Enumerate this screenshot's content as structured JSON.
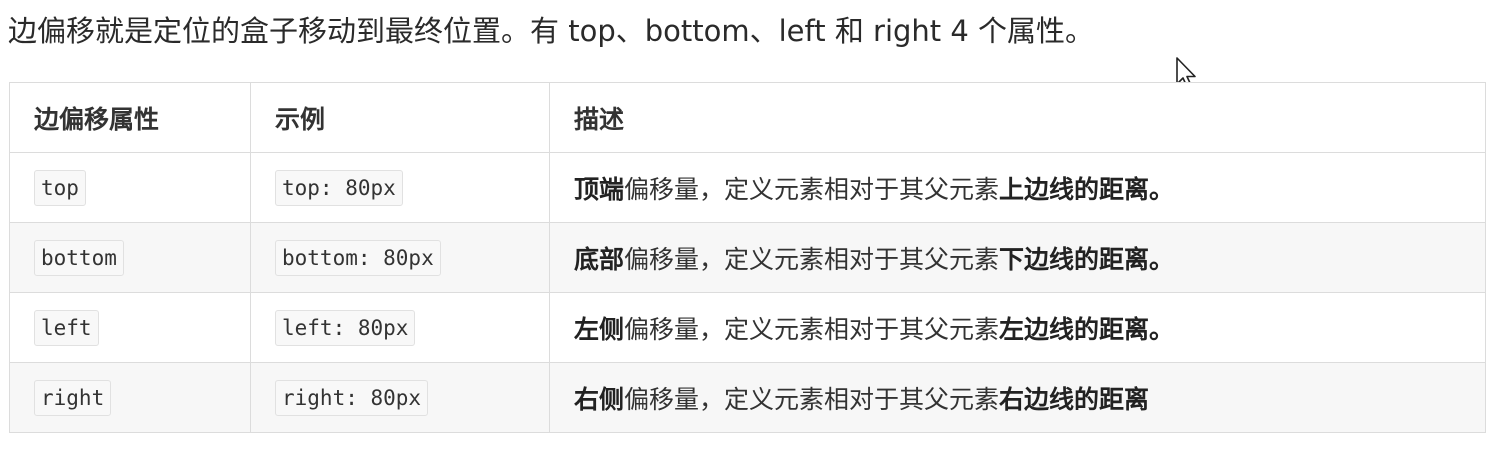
{
  "intro": "边偏移就是定位的盒子移动到最终位置。有 top、bottom、left 和 right  4 个属性。",
  "table": {
    "headers": [
      "边偏移属性",
      "示例",
      "描述"
    ],
    "rows": [
      {
        "property": "top",
        "example": "top: 80px",
        "desc_lead": "顶端",
        "desc_mid": "偏移量，定义元素相对于其父元素",
        "desc_tail": "上边线的距离。"
      },
      {
        "property": "bottom",
        "example": "bottom: 80px",
        "desc_lead": "底部",
        "desc_mid": "偏移量，定义元素相对于其父元素",
        "desc_tail": "下边线的距离。"
      },
      {
        "property": "left",
        "example": "left: 80px",
        "desc_lead": "左侧",
        "desc_mid": "偏移量，定义元素相对于其父元素",
        "desc_tail": "左边线的距离。"
      },
      {
        "property": "right",
        "example": "right: 80px",
        "desc_lead": "右侧",
        "desc_mid": "偏移量，定义元素相对于其父元素",
        "desc_tail": "右边线的距离"
      }
    ]
  },
  "colors": {
    "border": "#dcdcdc",
    "stripe": "#f7f7f7",
    "code_bg": "#f8f8f8",
    "text": "#333333"
  },
  "icons": {
    "cursor": "mouse-pointer-icon"
  }
}
